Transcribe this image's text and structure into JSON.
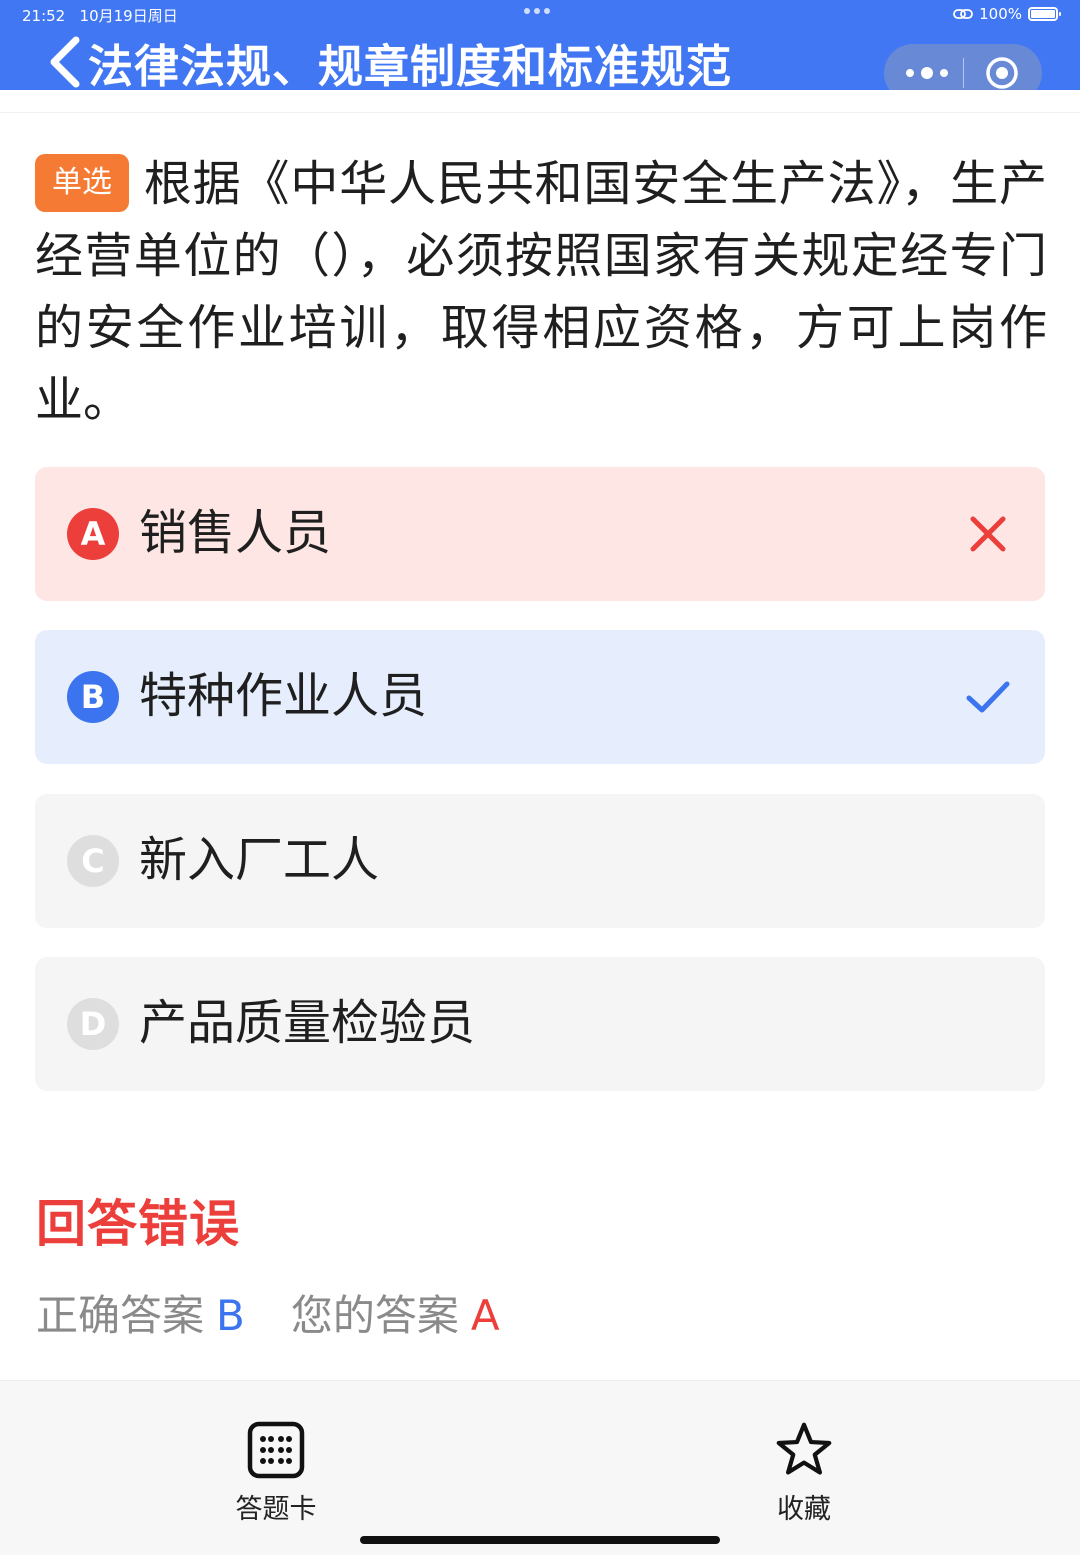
{
  "status_bar": {
    "time": "21:52",
    "date": "10月19日周日",
    "battery": "100%"
  },
  "header": {
    "title": "法律法规、规章制度和标准规范",
    "bg_color": "#4277f3"
  },
  "question": {
    "type_tag": "单选",
    "text": "根据《中华人民共和国安全生产法》，生产经营单位的（），必须按照国家有关规定经专门的安全作业培训，取得相应资格，方可上岗作业。"
  },
  "options": [
    {
      "letter": "A",
      "text": "销售人员",
      "state": "wrong",
      "mark": "cross-icon"
    },
    {
      "letter": "B",
      "text": "特种作业人员",
      "state": "correct",
      "mark": "check-icon"
    },
    {
      "letter": "C",
      "text": "新入厂工人",
      "state": "neutral"
    },
    {
      "letter": "D",
      "text": "产品质量检验员",
      "state": "neutral"
    }
  ],
  "result": {
    "title": "回答错误",
    "correct_label": "正确答案",
    "correct_value": "B",
    "your_label": "您的答案",
    "your_value": "A"
  },
  "bottom_bar": {
    "answer_card_label": "答题卡",
    "favorite_label": "收藏"
  },
  "colors": {
    "wrong": "#ec3f3b",
    "correct": "#3b74ee",
    "tag": "#f57a33"
  }
}
